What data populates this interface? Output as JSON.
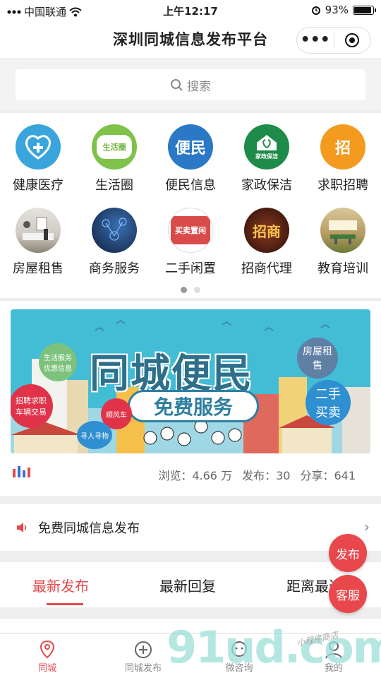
{
  "status_bar": {
    "carrier": "中国联通",
    "time": "上午12:17",
    "battery": "93%"
  },
  "nav": {
    "title": "深圳同城信息发布平台",
    "more": "•••"
  },
  "search": {
    "placeholder": "搜索"
  },
  "categories": [
    {
      "label": "健康医疗",
      "icon": "health-icon",
      "bg": "#3aa5dc"
    },
    {
      "label": "生活圈",
      "icon": "life-circle-icon",
      "bg": "#7ec24a",
      "badge": "生活圈"
    },
    {
      "label": "便民信息",
      "icon": "convenience-icon",
      "bg": "#2a78c6",
      "badge": "便民"
    },
    {
      "label": "家政保洁",
      "icon": "housekeeping-icon",
      "bg": "#1f8b4a",
      "badge": "家政保洁"
    },
    {
      "label": "求职招聘",
      "icon": "job-icon",
      "bg": "#f39a1f",
      "badge": "招"
    },
    {
      "label": "房屋租售",
      "icon": "house-icon",
      "bg": "#c9c7c2"
    },
    {
      "label": "商务服务",
      "icon": "business-icon",
      "bg": "#1e3b6e"
    },
    {
      "label": "二手闲置",
      "icon": "secondhand-icon",
      "bg": "#d94b4b",
      "badge": "买卖置闲"
    },
    {
      "label": "招商代理",
      "icon": "investment-icon",
      "bg": "#6a2c1e",
      "badge": "招商"
    },
    {
      "label": "教育培训",
      "icon": "education-icon",
      "bg": "#b59a61"
    }
  ],
  "banner": {
    "title": "同城便民",
    "subtitle": "免费服务",
    "bubbles": [
      "生活服务优惠信息",
      "招聘求职车辆交易",
      "顺风车",
      "寻人寻物",
      "房屋租售",
      "二手买卖"
    ]
  },
  "stats": {
    "views": "浏览：4.66 万",
    "posts": "发布：30",
    "shares": "分享：641"
  },
  "notice": {
    "text": "免费同城信息发布"
  },
  "tabs": [
    "最新发布",
    "最新回复",
    "距离最近"
  ],
  "fab": {
    "publish": "发布",
    "service": "客服"
  },
  "tabbar": [
    "同城",
    "同城发布",
    "微咨询",
    "我的"
  ],
  "watermark": {
    "main": "91ud.com",
    "sub": "小程序商店"
  },
  "colors": {
    "accent": "#e5484d",
    "banner_bg": "#43bcd5"
  }
}
